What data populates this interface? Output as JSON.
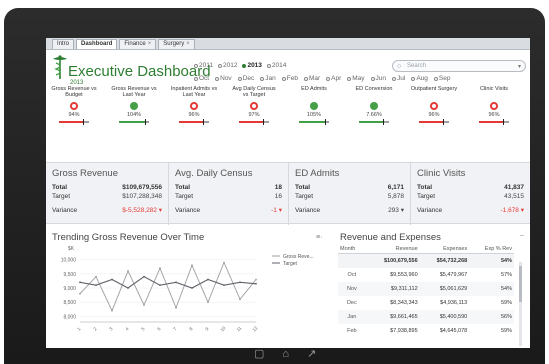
{
  "tabs": [
    {
      "label": "Intro",
      "close": ""
    },
    {
      "label": "Dashboard",
      "close": "",
      "active": true
    },
    {
      "label": "Finance",
      "close": "×"
    },
    {
      "label": "Surgery",
      "close": "×"
    }
  ],
  "header": {
    "title": "Executive Dashboard",
    "year_sub": "2013",
    "years": [
      {
        "label": "2011",
        "selected": false
      },
      {
        "label": "2012",
        "selected": false
      },
      {
        "label": "2013",
        "selected": true
      },
      {
        "label": "2014",
        "selected": false
      }
    ],
    "months": [
      "Oct",
      "Nov",
      "Dec",
      "Jan",
      "Feb",
      "Mar",
      "Apr",
      "May",
      "Jun",
      "Jul",
      "Aug",
      "Sep"
    ],
    "search_placeholder": "Search"
  },
  "kpis": [
    {
      "label": "Gross Revenue vs Budget",
      "pct": "94%",
      "status": "red",
      "level": 0.94
    },
    {
      "label": "Gross Revenue vs Last Year",
      "pct": "104%",
      "status": "green",
      "level": 1.04
    },
    {
      "label": "Inpatient Admits vs Last Year",
      "pct": "96%",
      "status": "red",
      "level": 0.96
    },
    {
      "label": "Avg Daily Census vs Target",
      "pct": "97%",
      "status": "red",
      "level": 0.97
    },
    {
      "label": "ED Admits",
      "pct": "105%",
      "status": "green",
      "level": 1.05
    },
    {
      "label": "ED Conversion",
      "pct": "7.66%",
      "status": "green",
      "level": 0.95
    },
    {
      "label": "Outpatient Surgery",
      "pct": "96%",
      "status": "red",
      "level": 0.96
    },
    {
      "label": "Clinic Visits",
      "pct": "96%",
      "status": "red",
      "level": 0.96
    }
  ],
  "panels": [
    {
      "title": "Gross Revenue",
      "total": "$109,679,556",
      "target": "$107,288,348",
      "variance": "$-5,528,282",
      "variance_negative": true,
      "arrow": "▾"
    },
    {
      "title": "Avg. Daily Census",
      "total": "18",
      "target": "16",
      "variance": "-1",
      "variance_negative": true,
      "arrow": "▾"
    },
    {
      "title": "ED Admits",
      "total": "6,171",
      "target": "5,878",
      "variance": "293",
      "variance_negative": false,
      "arrow": "▾"
    },
    {
      "title": "Clinic Visits",
      "total": "41,837",
      "target": "43,515",
      "variance": "-1,678",
      "variance_negative": true,
      "arrow": "▾"
    }
  ],
  "labels": {
    "total": "Total",
    "target": "Target",
    "variance": "Variance"
  },
  "trend": {
    "title": "Trending Gross Revenue Over Time",
    "menu_icon": "≡·"
  },
  "chart_data": {
    "type": "line",
    "title": "Trending Gross Revenue Over Time",
    "ylabel": "$K",
    "y_ticks": [
      "10,000",
      "9,500",
      "9,000",
      "8,500",
      "8,000"
    ],
    "ylim": [
      7800,
      10200
    ],
    "x": [
      1,
      2,
      3,
      4,
      5,
      6,
      7,
      8,
      9,
      10,
      11,
      12
    ],
    "series": [
      {
        "name": "Gross Reve...",
        "values": [
          8800,
          9400,
          8200,
          9600,
          8400,
          9700,
          8300,
          9800,
          8500,
          9900,
          8600,
          9300
        ]
      },
      {
        "name": "Target",
        "values": [
          9200,
          9100,
          9300,
          9000,
          9400,
          9100,
          9200,
          9000,
          9300,
          9100,
          9200,
          9150
        ]
      }
    ],
    "legend": "right"
  },
  "revenue": {
    "title": "Revenue and Expenses",
    "columns": [
      "Month",
      "Revenue",
      "Expenses",
      "Exp % Rev"
    ],
    "total_row": [
      "",
      "$100,679,556",
      "$54,732,268",
      "54%"
    ],
    "rows": [
      [
        "Oct",
        "$9,553,960",
        "$5,479,967",
        "57%"
      ],
      [
        "Nov",
        "$9,311,112",
        "$5,061,629",
        "54%"
      ],
      [
        "Dec",
        "$8,343,343",
        "$4,936,113",
        "59%"
      ],
      [
        "Jan",
        "$9,661,465",
        "$5,400,590",
        "56%"
      ],
      [
        "Feb",
        "$7,938,895",
        "$4,645,078",
        "59%"
      ]
    ]
  },
  "bezel": [
    "lock-icon",
    "home-icon",
    "settings-icon"
  ]
}
